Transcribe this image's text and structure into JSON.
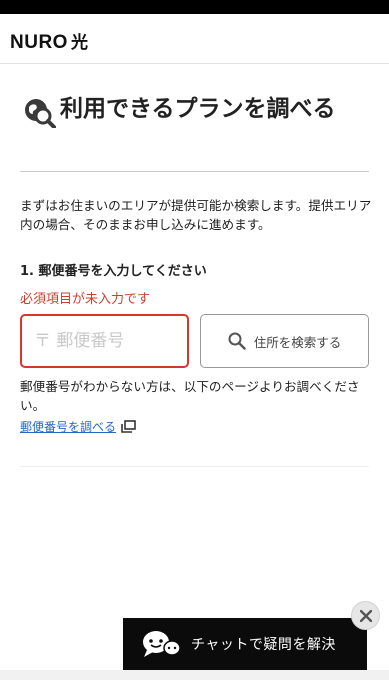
{
  "header": {
    "logo_text": "NURO",
    "logo_suffix": "光"
  },
  "page": {
    "title": "利用できるプランを調べる",
    "title_icon": "search-location-icon",
    "intro": "まずはお住まいのエリアが提供可能か検索します。提供エリア内の場合、そのままお申し込みに進めます。"
  },
  "form": {
    "step_label": "1. 郵便番号を入力してください",
    "error": "必須項目が未入力です",
    "zip_placeholder": "〒 郵便番号",
    "zip_value": "",
    "search_button_label": "住所を検索する",
    "search_icon": "search-icon",
    "help_text": "郵便番号がわからない方は、以下のページよりお調べください。",
    "zip_link_label": "郵便番号を調べる",
    "external_link_icon": "external-link-icon"
  },
  "chat": {
    "label": "チャットで疑問を解決",
    "icon": "chat-bubbles-icon",
    "close_icon": "close-icon"
  },
  "colors": {
    "error": "#c8412f",
    "link": "#2a66c4",
    "chat_bg": "#0b0b0b"
  }
}
